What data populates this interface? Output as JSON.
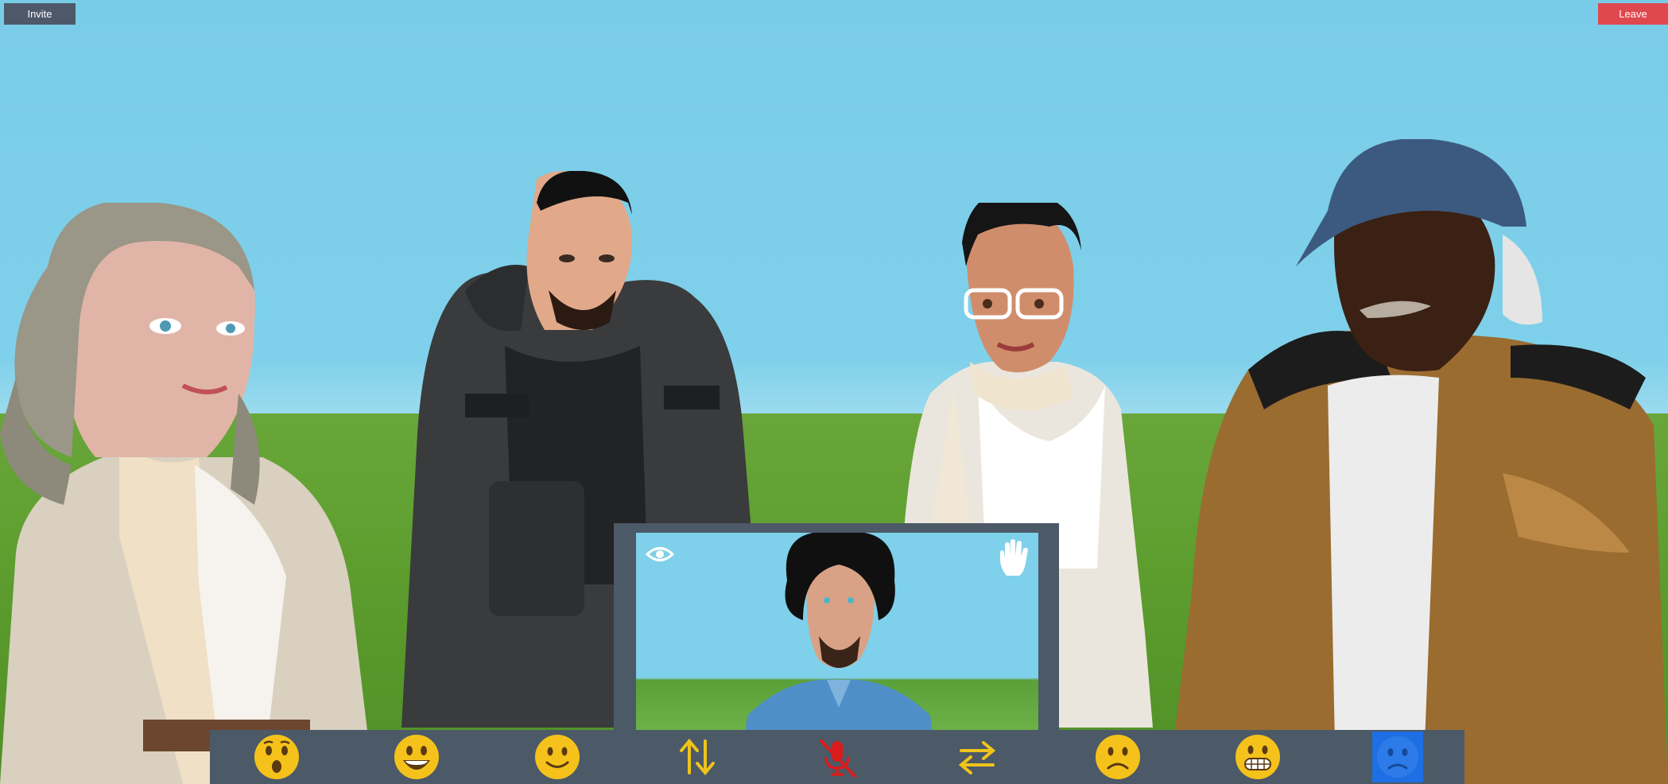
{
  "header": {
    "invite_label": "Invite",
    "leave_label": "Leave"
  },
  "colors": {
    "invite_bg": "#4d5968",
    "leave_bg": "#e0484f",
    "panel_bg": "#4c5967",
    "sky": "#79cce8",
    "grass": "#5e9e2f",
    "active_tool": "#1e6fe3",
    "emoji": "#f5c21b",
    "arrows": "#f0c419",
    "mute": "#d81c1c"
  },
  "self_view": {
    "left_icon": "eye-icon",
    "right_icon": "raise-hand-icon"
  },
  "toolbar": {
    "items": [
      {
        "icon": "surprised-emoji-icon"
      },
      {
        "icon": "grinning-emoji-icon"
      },
      {
        "icon": "smile-emoji-icon"
      },
      {
        "icon": "swap-vertical-icon"
      },
      {
        "icon": "microphone-muted-icon"
      },
      {
        "icon": "swap-horizontal-icon"
      },
      {
        "icon": "frown-emoji-icon"
      },
      {
        "icon": "grimace-emoji-icon"
      },
      {
        "icon": "sad-emoji-icon",
        "active": true
      }
    ]
  }
}
